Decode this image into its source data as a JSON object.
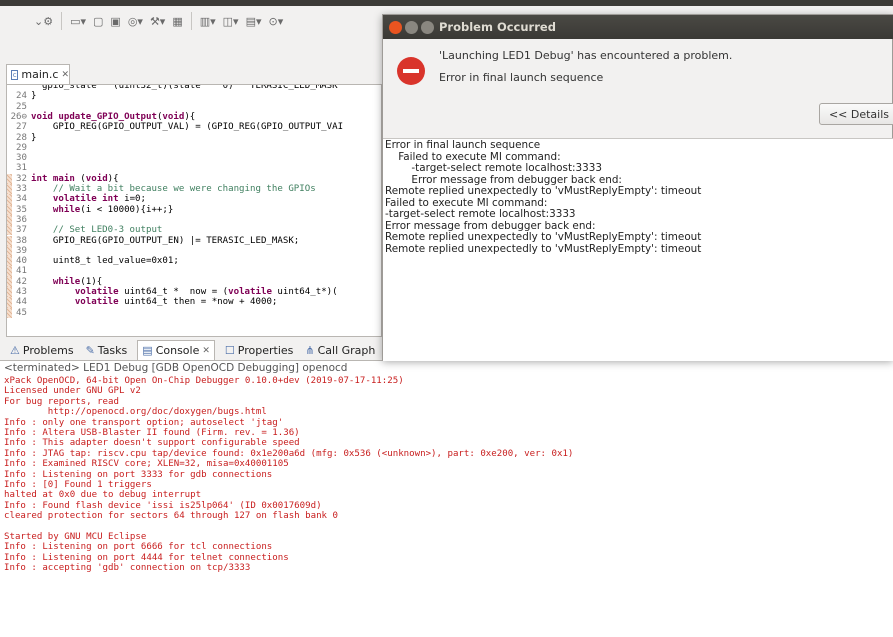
{
  "toolbar": {
    "icons": [
      "settings-dropdown-icon",
      "new-icon",
      "save-icon",
      "save-all-icon",
      "debug-icon",
      "build-icon",
      "external-tools-icon",
      "new-window-icon",
      "open-type-icon",
      "open-file-icon",
      "run-icon"
    ]
  },
  "editor": {
    "tab_label": "main.c",
    "tab_close": "✕",
    "lines": [
      {
        "n": "",
        "segs": [
          {
            "t": "  gpio_state   (uint32_t)(state    0)   TERASIC_LED_MASK",
            "c": "code"
          }
        ]
      },
      {
        "n": "24",
        "segs": [
          {
            "t": "}",
            "c": "code"
          }
        ]
      },
      {
        "n": "25",
        "segs": []
      },
      {
        "n": "26⊖",
        "segs": [
          {
            "t": "void ",
            "c": "kw"
          },
          {
            "t": "update_GPIO_Output",
            "c": "kw"
          },
          {
            "t": "(",
            "c": "code"
          },
          {
            "t": "void",
            "c": "kw"
          },
          {
            "t": "){",
            "c": "code"
          }
        ]
      },
      {
        "n": "27",
        "segs": [
          {
            "t": "    GPIO_REG(GPIO_OUTPUT_VAL) = (GPIO_REG(GPIO_OUTPUT_VAI",
            "c": "code"
          }
        ]
      },
      {
        "n": "28",
        "segs": [
          {
            "t": "}",
            "c": "code"
          }
        ]
      },
      {
        "n": "29",
        "segs": []
      },
      {
        "n": "30",
        "segs": []
      },
      {
        "n": "31",
        "segs": []
      },
      {
        "n": "32",
        "mark": true,
        "segs": [
          {
            "t": "int ",
            "c": "kw"
          },
          {
            "t": "main ",
            "c": "kw"
          },
          {
            "t": "(",
            "c": "code"
          },
          {
            "t": "void",
            "c": "kw"
          },
          {
            "t": "){",
            "c": "code"
          }
        ]
      },
      {
        "n": "33",
        "mark": true,
        "segs": [
          {
            "t": "    // Wait a bit because we were changing the GPIOs",
            "c": "cm"
          }
        ]
      },
      {
        "n": "34",
        "mark": true,
        "segs": [
          {
            "t": "    ",
            "c": "code"
          },
          {
            "t": "volatile int ",
            "c": "kw"
          },
          {
            "t": "i=0;",
            "c": "code"
          }
        ]
      },
      {
        "n": "35",
        "mark": true,
        "segs": [
          {
            "t": "    ",
            "c": "code"
          },
          {
            "t": "while",
            "c": "kw"
          },
          {
            "t": "(i < 10000){i++;}",
            "c": "code"
          }
        ]
      },
      {
        "n": "36",
        "mark": true,
        "segs": []
      },
      {
        "n": "37",
        "mark": true,
        "segs": [
          {
            "t": "    // Set LED0-3 output",
            "c": "cm"
          }
        ]
      },
      {
        "n": "38",
        "mark": true,
        "segs": [
          {
            "t": "    GPIO_REG(GPIO_OUTPUT_EN) |= TERASIC_LED_MASK;",
            "c": "code"
          }
        ]
      },
      {
        "n": "39",
        "mark": true,
        "segs": []
      },
      {
        "n": "40",
        "mark": true,
        "segs": [
          {
            "t": "    uint8_t led_value=0x01;",
            "c": "code"
          }
        ]
      },
      {
        "n": "41",
        "mark": true,
        "segs": []
      },
      {
        "n": "42",
        "mark": true,
        "segs": [
          {
            "t": "    ",
            "c": "code"
          },
          {
            "t": "while",
            "c": "kw"
          },
          {
            "t": "(1){",
            "c": "code"
          }
        ]
      },
      {
        "n": "43",
        "mark": true,
        "segs": [
          {
            "t": "        ",
            "c": "code"
          },
          {
            "t": "volatile ",
            "c": "kw"
          },
          {
            "t": "uint64_t *  now = (",
            "c": "code"
          },
          {
            "t": "volatile ",
            "c": "kw"
          },
          {
            "t": "uint64_t*)(",
            "c": "code"
          }
        ]
      },
      {
        "n": "44",
        "mark": true,
        "segs": [
          {
            "t": "        ",
            "c": "code"
          },
          {
            "t": "volatile ",
            "c": "kw"
          },
          {
            "t": "uint64_t then = *now + 4000;",
            "c": "code"
          }
        ]
      },
      {
        "n": "45",
        "mark": true,
        "segs": []
      }
    ]
  },
  "views": {
    "tabs": [
      {
        "label": "Problems",
        "icon": "problems-icon",
        "glyph": "⚠",
        "active": false
      },
      {
        "label": "Tasks",
        "icon": "tasks-icon",
        "glyph": "✎",
        "active": false
      },
      {
        "label": "Console",
        "icon": "console-icon",
        "glyph": "▤",
        "active": true,
        "close": "✕"
      },
      {
        "label": "Properties",
        "icon": "properties-icon",
        "glyph": "☐",
        "active": false
      },
      {
        "label": "Call Graph",
        "icon": "call-graph-icon",
        "glyph": "⋔",
        "active": false
      }
    ]
  },
  "console": {
    "header": "<terminated> LED1 Debug [GDB OpenOCD Debugging] openocd",
    "lines": [
      "xPack OpenOCD, 64-bit Open On-Chip Debugger 0.10.0+dev (2019-07-17-11:25)",
      "Licensed under GNU GPL v2",
      "For bug reports, read",
      "        http://openocd.org/doc/doxygen/bugs.html",
      "Info : only one transport option; autoselect 'jtag'",
      "Info : Altera USB-Blaster II found (Firm. rev. = 1.36)",
      "Info : This adapter doesn't support configurable speed",
      "Info : JTAG tap: riscv.cpu tap/device found: 0x1e200a6d (mfg: 0x536 (<unknown>), part: 0xe200, ver: 0x1)",
      "Info : Examined RISCV core; XLEN=32, misa=0x40001105",
      "Info : Listening on port 3333 for gdb connections",
      "Info : [0] Found 1 triggers",
      "halted at 0x0 due to debug interrupt",
      "Info : Found flash device 'issi is25lp064' (ID 0x0017609d)",
      "cleared protection for sectors 64 through 127 on flash bank 0",
      "",
      "Started by GNU MCU Eclipse",
      "Info : Listening on port 6666 for tcl connections",
      "Info : Listening on port 4444 for telnet connections",
      "Info : accepting 'gdb' connection on tcp/3333"
    ]
  },
  "dialog": {
    "title": "Problem Occurred",
    "message": "'Launching LED1 Debug' has encountered a problem.",
    "submessage": "Error in final launch sequence",
    "details_button": "<< Details",
    "colors": {
      "close": "#e95420",
      "min": "#8a8780",
      "max": "#8a8780"
    },
    "details": [
      "Error in final launch sequence",
      "    Failed to execute MI command:",
      "        -target-select remote localhost:3333",
      "        Error message from debugger back end:",
      "Remote replied unexpectedly to 'vMustReplyEmpty': timeout",
      "Failed to execute MI command:",
      "-target-select remote localhost:3333",
      "Error message from debugger back end:",
      "Remote replied unexpectedly to 'vMustReplyEmpty': timeout",
      "Remote replied unexpectedly to 'vMustReplyEmpty': timeout"
    ]
  }
}
